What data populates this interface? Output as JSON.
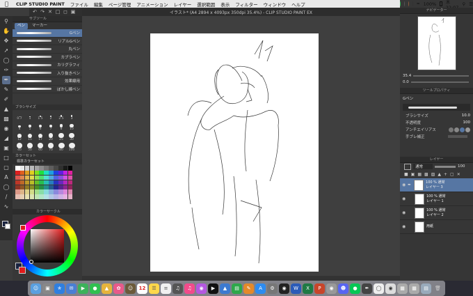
{
  "menubar": {
    "app_name": "CLIP STUDIO PAINT",
    "items": [
      "ファイル",
      "編集",
      "ページ管理",
      "アニメーション",
      "レイヤー",
      "選択範囲",
      "表示",
      "フィルター",
      "ウィンドウ",
      "ヘルプ"
    ],
    "battery": "100%",
    "clock": "木 22:07"
  },
  "window": {
    "title": "イラスト* (A4 2894 x 4093px 350dpi 35.4%)  - CLIP STUDIO PAINT EX"
  },
  "subtool_panel": {
    "header": "サブツール",
    "tabs": [
      "ペン",
      "マーカー"
    ],
    "brushes": [
      "Gペン",
      "リアルGペン",
      "丸ペン",
      "カブラペン",
      "カリグラフィ",
      "入り抜きペン",
      "効果線用",
      "ぼかし線ペン"
    ],
    "active_brush": "Gペン"
  },
  "brush_size_panel": {
    "header": "ブラシサイズ",
    "sizes": [
      "0.7",
      "1",
      "1.5",
      "2",
      "2.5",
      "3",
      "4",
      "5",
      "6",
      "7",
      "8",
      "10",
      "12",
      "15",
      "17",
      "20",
      "25",
      "30",
      "40",
      "50",
      "60",
      "70",
      "80",
      "100"
    ]
  },
  "color_set_panel": {
    "header": "カラーセット",
    "set_name": "標準カラーセット"
  },
  "color_wheel_panel": {
    "header": "カラーサークル"
  },
  "navigator": {
    "header": "ナビゲーター",
    "zoom": "35.4",
    "rotation": "0.0"
  },
  "tool_property": {
    "header": "ツールプロパティ",
    "brush_name": "Gペン",
    "rows": [
      {
        "label": "ブラシサイズ",
        "value": "10.0"
      },
      {
        "label": "不透明度",
        "value": "100"
      },
      {
        "label": "アンチエイリアス",
        "value": ""
      },
      {
        "label": "手ブレ補正",
        "value": ""
      }
    ]
  },
  "layer_panel": {
    "header": "レイヤー",
    "blend_mode": "通常",
    "opacity": "100",
    "layers": [
      {
        "opacity": "100 %",
        "mode": "通常",
        "name": "レイヤー 3",
        "active": true
      },
      {
        "opacity": "100 %",
        "mode": "通常",
        "name": "レイヤー 1",
        "active": false
      },
      {
        "opacity": "100 %",
        "mode": "通常",
        "name": "レイヤー 2",
        "active": false
      },
      {
        "opacity": "",
        "mode": "",
        "name": "用紙",
        "active": false
      }
    ]
  },
  "dock": {
    "calendar_day": "12"
  },
  "colors": {
    "accent": "#5676a3",
    "panel_bg": "#383838",
    "canvas_bg": "#ffffff"
  }
}
